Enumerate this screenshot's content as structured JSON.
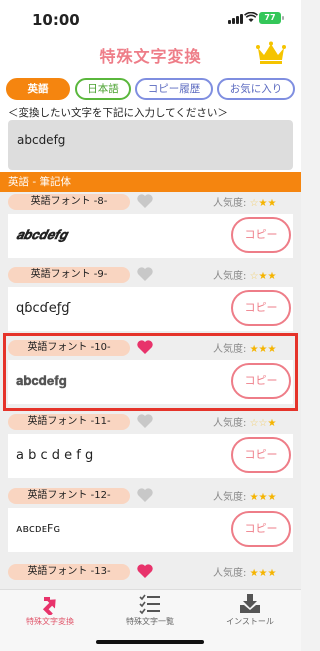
{
  "status": {
    "time": "10:00",
    "battery": "77"
  },
  "header": {
    "title": "特殊文字変換"
  },
  "tabs": [
    "英語",
    "日本語",
    "コピー履歴",
    "お気に入り"
  ],
  "prompt": "＜変換したい文字を下記に入力してください＞",
  "input": {
    "value": "abcdefg"
  },
  "section_title": "英語 - 筆記体",
  "popularity_label": "人気度:",
  "copy_label": "コピー",
  "fonts": [
    {
      "name": "英語フォント -8-",
      "sample": "𝒂𝒃𝒄𝒅𝒆𝒇𝒈",
      "favorite": false,
      "stars": 2
    },
    {
      "name": "英語フォント -9-",
      "sample": "ɋɓcɗeƒɠ",
      "favorite": false,
      "stars": 2
    },
    {
      "name": "英語フォント -10-",
      "sample": "𝐚𝐛𝐜𝐝𝐞𝐟𝐠",
      "favorite": true,
      "stars": 3
    },
    {
      "name": "英語フォント -11-",
      "sample": "a b c d e f g",
      "favorite": false,
      "stars": 2
    },
    {
      "name": "英語フォント -12-",
      "sample": "ᴀʙᴄᴅᴇFɢ",
      "favorite": false,
      "stars": 3
    },
    {
      "name": "英語フォント -13-",
      "sample": "",
      "favorite": true,
      "stars": 3
    }
  ],
  "bottom_nav": [
    "特殊文字変換",
    "特殊文字一覧",
    "インストール"
  ]
}
